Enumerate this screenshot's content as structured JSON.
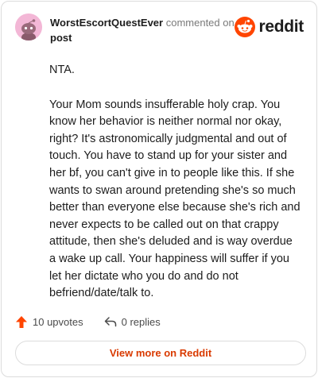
{
  "comment": {
    "username": "WorstEscortQuestEver",
    "action": "commented on",
    "post_link": "post",
    "paragraphs": [
      "NTA.",
      "Your Mom sounds insufferable holy crap. You know her behavior is neither normal nor okay, right? It's astronomically judgmental and out of touch. You have to stand up for your sister and her bf, you can't give in to people like this. If she wants to swan around pretending she's so much better than everyone else because she's rich and never expects to be called out on that crappy attitude, then she's deluded and is way overdue a wake up call. Your happiness will suffer if you let her dictate who you do and do not befriend/date/talk to."
    ]
  },
  "brand": {
    "wordmark": "reddit",
    "icon": "reddit-snoo-icon",
    "color": "#ff4500"
  },
  "stats": {
    "upvotes": "10 upvotes",
    "replies": "0 replies",
    "upvote_icon": "upvote-arrow-icon",
    "reply_icon": "reply-arrow-icon",
    "upvote_color": "#ff4500"
  },
  "cta": {
    "label": "View more on Reddit",
    "color": "#d93a00"
  }
}
